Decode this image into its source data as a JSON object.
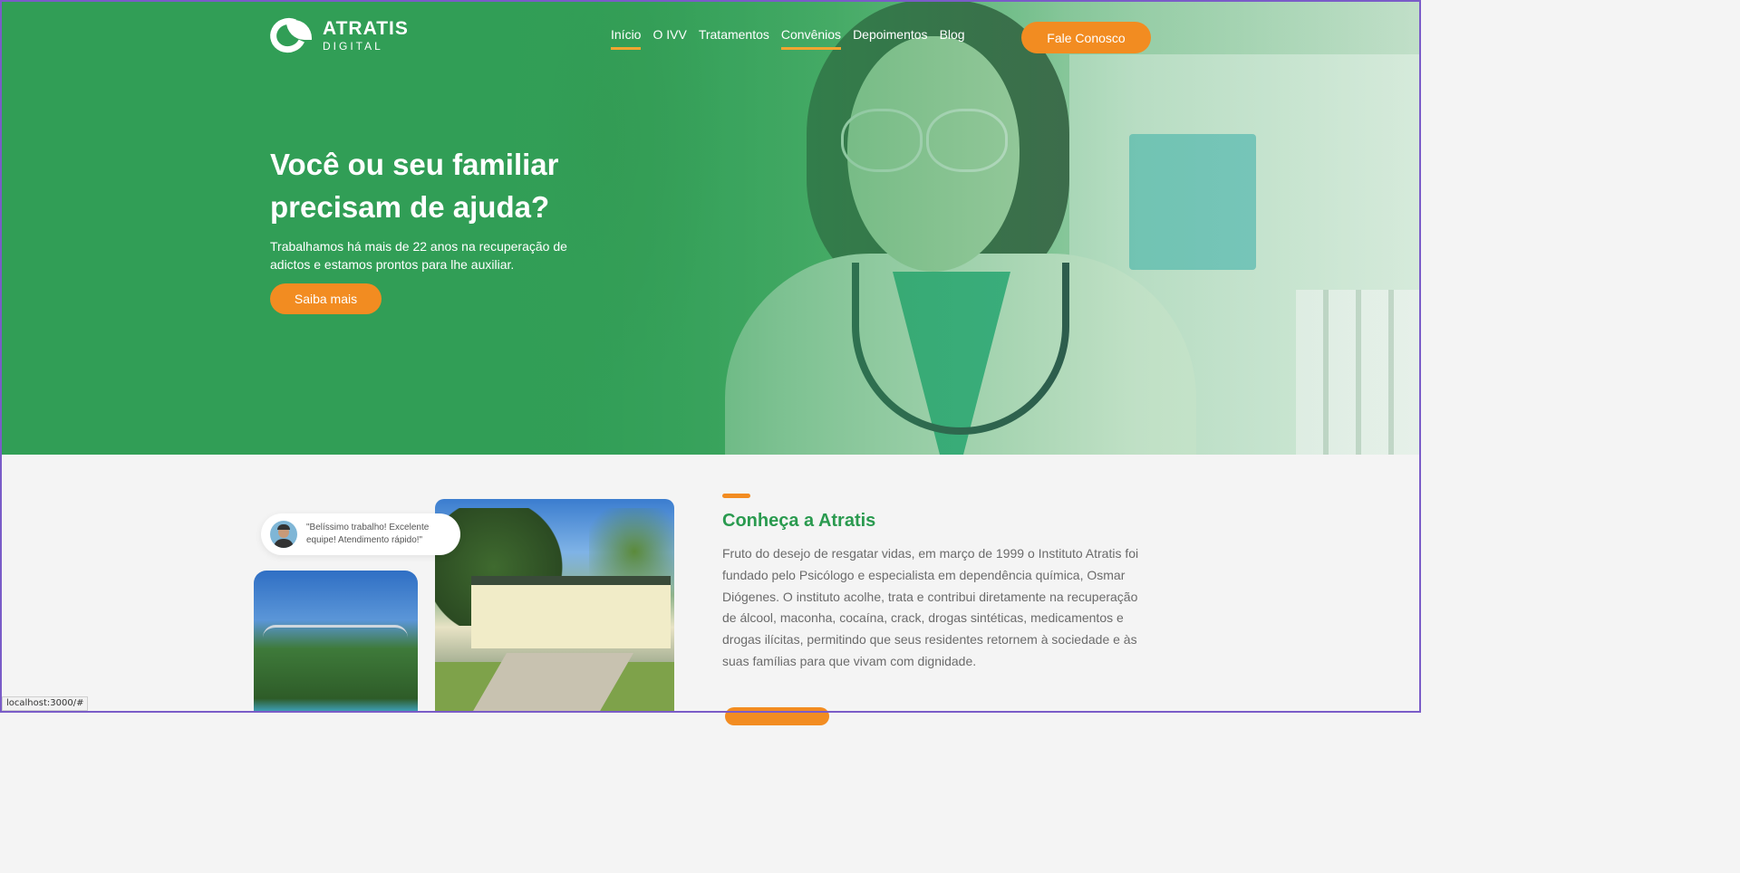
{
  "logo": {
    "line1": "ATRATIS",
    "line2": "DIGITAL"
  },
  "nav": {
    "items": [
      {
        "label": "Início",
        "active": true
      },
      {
        "label": "O IVV",
        "active": false
      },
      {
        "label": "Tratamentos",
        "active": false
      },
      {
        "label": "Convênios",
        "active": true
      },
      {
        "label": "Depoimentos",
        "active": false
      },
      {
        "label": "Blog",
        "active": false
      }
    ],
    "cta": "Fale Conosco"
  },
  "hero": {
    "title": "Você ou seu familiar precisam de ajuda?",
    "subtitle": "Trabalhamos há mais de 22 anos na recuperação de adictos e estamos prontos para lhe auxiliar.",
    "button": "Saiba mais"
  },
  "testimonial": {
    "text": "\"Belíssimo trabalho! Excelente equipe! Atendimento rápido!\""
  },
  "about": {
    "title": "Conheça a Atratis",
    "text": "Fruto do desejo de resgatar vidas, em março de 1999 o Instituto Atratis foi fundado pelo Psicólogo e especialista em dependência química, Osmar Diógenes. O instituto acolhe, trata e contribui diretamente na recuperação de álcool, maconha, cocaína, crack, drogas sintéticas, medicamentos e drogas ilícitas, permitindo que seus residentes retornem à sociedade e às suas famílias para que vivam com dignidade."
  },
  "status_bar": {
    "url": "localhost:3000/#"
  },
  "colors": {
    "brand_green": "#2a9a4f",
    "hero_green": "#319e56",
    "accent_orange": "#f28c21",
    "underline": "#f2a531"
  }
}
